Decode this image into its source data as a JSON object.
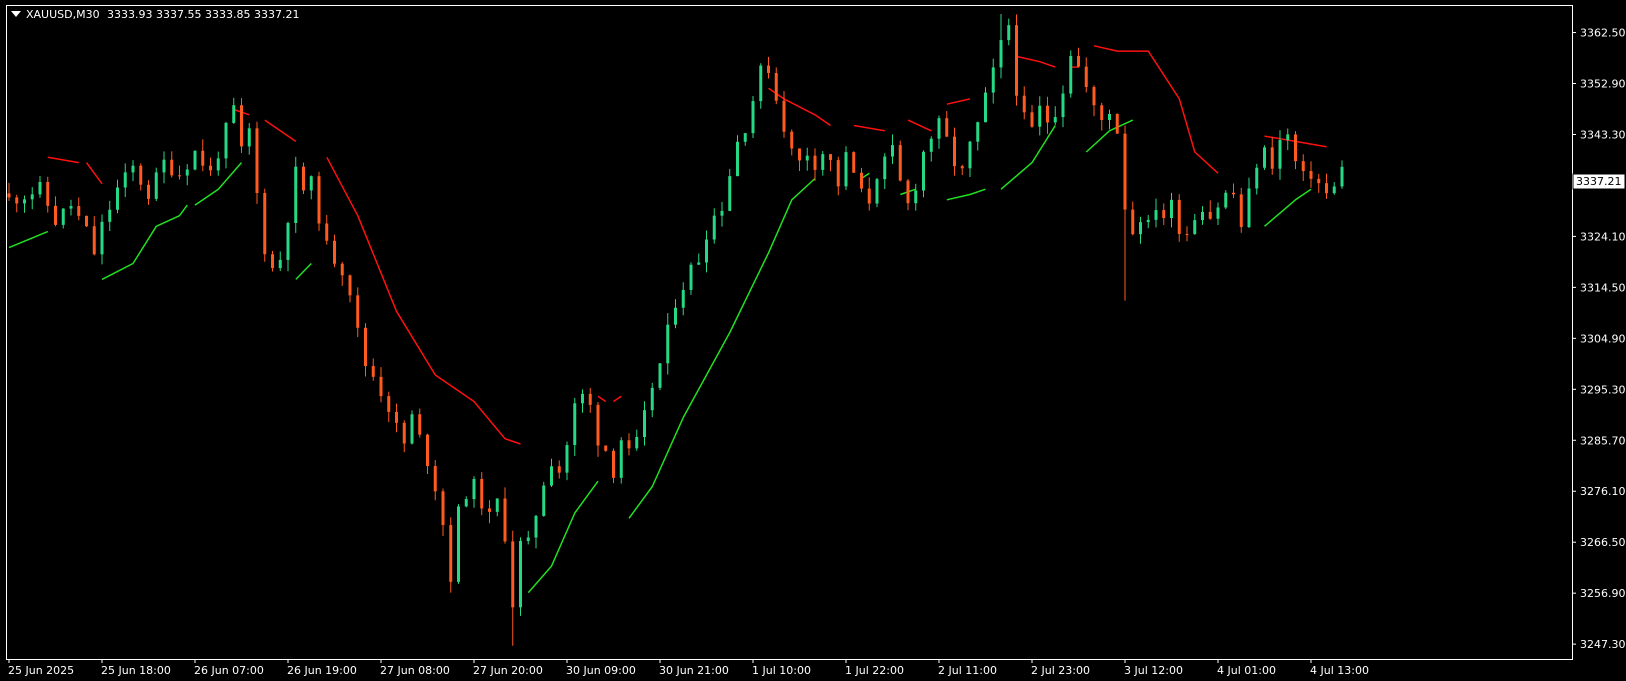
{
  "header": {
    "symbol": "XAUUSD,M30",
    "ohlc": "3333.93 3337.55 3333.85 3337.21"
  },
  "current_price_label": "3337.21",
  "colors": {
    "background": "#000000",
    "frame": "#ffffff",
    "bull_candle": "#26d984",
    "bear_candle": "#ff5a1f",
    "band_lower": "#21e021",
    "band_upper": "#ff1010",
    "text": "#ffffff"
  },
  "chart_data": {
    "type": "line",
    "instrument": "XAUUSD",
    "timeframe": "M30",
    "ylim": [
      3244.5,
      3367.5
    ],
    "y_ticks": [
      3362.5,
      3352.9,
      3343.3,
      3333.7,
      3324.1,
      3314.5,
      3304.9,
      3295.3,
      3285.7,
      3276.1,
      3266.5,
      3256.9,
      3247.3
    ],
    "y_tick_labels": [
      "3362.50",
      "3352.90",
      "3343.30",
      "3333.70",
      "3324.10",
      "3314.50",
      "3304.90",
      "3295.30",
      "3285.70",
      "3276.10",
      "3266.50",
      "3256.90",
      "3247.30"
    ],
    "x_range": [
      0,
      200
    ],
    "x_ticks": [
      0,
      12,
      24,
      36,
      48,
      60,
      72,
      84,
      96,
      108,
      120,
      132,
      144,
      156,
      168
    ],
    "x_tick_labels": [
      "25 Jun 2025",
      "25 Jun 18:00",
      "26 Jun 07:00",
      "26 Jun 19:00",
      "27 Jun 08:00",
      "27 Jun 20:00",
      "30 Jun 09:00",
      "30 Jun 21:00",
      "1 Jul 10:00",
      "1 Jul 22:00",
      "2 Jul 11:00",
      "2 Jul 23:00",
      "3 Jul 12:00",
      "4 Jul 01:00",
      "4 Jul 13:00"
    ],
    "price_anchors": [
      [
        0,
        3331
      ],
      [
        4,
        3333
      ],
      [
        6,
        3327
      ],
      [
        8,
        3330
      ],
      [
        10,
        3325
      ],
      [
        11,
        3321
      ],
      [
        12,
        3326
      ],
      [
        14,
        3333
      ],
      [
        16,
        3337
      ],
      [
        18,
        3332
      ],
      [
        20,
        3338
      ],
      [
        22,
        3336
      ],
      [
        24,
        3340
      ],
      [
        26,
        3336
      ],
      [
        28,
        3344
      ],
      [
        29,
        3348
      ],
      [
        30,
        3340
      ],
      [
        31,
        3344
      ],
      [
        32,
        3332
      ],
      [
        33,
        3322
      ],
      [
        34,
        3318
      ],
      [
        35,
        3320
      ],
      [
        36,
        3328
      ],
      [
        37,
        3336
      ],
      [
        38,
        3333
      ],
      [
        39,
        3334
      ],
      [
        40,
        3328
      ],
      [
        41,
        3322
      ],
      [
        42,
        3320
      ],
      [
        43,
        3318
      ],
      [
        44,
        3314
      ],
      [
        45,
        3306
      ],
      [
        46,
        3300
      ],
      [
        47,
        3298
      ],
      [
        48,
        3295
      ],
      [
        49,
        3292
      ],
      [
        50,
        3288
      ],
      [
        51,
        3285
      ],
      [
        52,
        3290
      ],
      [
        53,
        3286
      ],
      [
        54,
        3282
      ],
      [
        55,
        3277
      ],
      [
        56,
        3270
      ],
      [
        57,
        3260
      ],
      [
        58,
        3272
      ],
      [
        59,
        3276
      ],
      [
        60,
        3277
      ],
      [
        61,
        3274
      ],
      [
        62,
        3271
      ],
      [
        63,
        3274
      ],
      [
        64,
        3268
      ],
      [
        65,
        3255
      ],
      [
        66,
        3266
      ],
      [
        67,
        3266
      ],
      [
        68,
        3272
      ],
      [
        69,
        3278
      ],
      [
        70,
        3282
      ],
      [
        71,
        3280
      ],
      [
        72,
        3285
      ],
      [
        73,
        3292
      ],
      [
        74,
        3294
      ],
      [
        75,
        3292
      ],
      [
        76,
        3286
      ],
      [
        77,
        3284
      ],
      [
        78,
        3280
      ],
      [
        79,
        3286
      ],
      [
        80,
        3283
      ],
      [
        81,
        3285
      ],
      [
        82,
        3290
      ],
      [
        83,
        3296
      ],
      [
        84,
        3300
      ],
      [
        85,
        3306
      ],
      [
        86,
        3312
      ],
      [
        87,
        3315
      ],
      [
        88,
        3318
      ],
      [
        89,
        3320
      ],
      [
        90,
        3325
      ],
      [
        91,
        3328
      ],
      [
        92,
        3330
      ],
      [
        93,
        3336
      ],
      [
        94,
        3342
      ],
      [
        95,
        3345
      ],
      [
        96,
        3350
      ],
      [
        97,
        3355
      ],
      [
        98,
        3356
      ],
      [
        99,
        3350
      ],
      [
        100,
        3345
      ],
      [
        101,
        3340
      ],
      [
        102,
        3338
      ],
      [
        103,
        3340
      ],
      [
        104,
        3338
      ],
      [
        105,
        3340
      ],
      [
        106,
        3338
      ],
      [
        107,
        3334
      ],
      [
        108,
        3339
      ],
      [
        109,
        3336
      ],
      [
        110,
        3332
      ],
      [
        111,
        3331
      ],
      [
        112,
        3336
      ],
      [
        113,
        3338
      ],
      [
        114,
        3340
      ],
      [
        115,
        3334
      ],
      [
        116,
        3330
      ],
      [
        117,
        3334
      ],
      [
        118,
        3340
      ],
      [
        119,
        3343
      ],
      [
        120,
        3345
      ],
      [
        121,
        3342
      ],
      [
        122,
        3338
      ],
      [
        123,
        3336
      ],
      [
        124,
        3341
      ],
      [
        125,
        3345
      ],
      [
        126,
        3350
      ],
      [
        127,
        3355
      ],
      [
        128,
        3360
      ],
      [
        129,
        3364
      ],
      [
        130,
        3352
      ],
      [
        131,
        3346
      ],
      [
        132,
        3344
      ],
      [
        133,
        3348
      ],
      [
        134,
        3346
      ],
      [
        135,
        3348
      ],
      [
        136,
        3352
      ],
      [
        137,
        3359
      ],
      [
        138,
        3356
      ],
      [
        139,
        3352
      ],
      [
        140,
        3348
      ],
      [
        141,
        3346
      ],
      [
        142,
        3348
      ],
      [
        143,
        3344
      ],
      [
        144,
        3330
      ],
      [
        145,
        3325
      ],
      [
        146,
        3328
      ],
      [
        147,
        3326
      ],
      [
        148,
        3330
      ],
      [
        149,
        3328
      ],
      [
        150,
        3330
      ],
      [
        151,
        3326
      ],
      [
        152,
        3325
      ],
      [
        153,
        3328
      ],
      [
        154,
        3330
      ],
      [
        155,
        3328
      ],
      [
        156,
        3330
      ],
      [
        157,
        3332
      ],
      [
        158,
        3332
      ],
      [
        159,
        3326
      ],
      [
        160,
        3332
      ],
      [
        161,
        3338
      ],
      [
        162,
        3340
      ],
      [
        163,
        3338
      ],
      [
        164,
        3342
      ],
      [
        165,
        3343
      ],
      [
        166,
        3338
      ],
      [
        167,
        3335
      ],
      [
        168,
        3336
      ],
      [
        169,
        3334
      ],
      [
        170,
        3332
      ],
      [
        171,
        3333
      ],
      [
        172,
        3337.21
      ]
    ],
    "wick_spikes": [
      [
        57,
        3257
      ],
      [
        65,
        3247
      ],
      [
        144,
        3312
      ],
      [
        29,
        3349
      ],
      [
        128,
        3366
      ]
    ],
    "series": [
      {
        "style": "line",
        "color": "#ff1010",
        "segments": [
          [
            [
              5,
              3339
            ],
            [
              9,
              3338
            ]
          ],
          [
            [
              10,
              3338
            ],
            [
              12,
              3334
            ]
          ],
          [
            [
              29,
              3348
            ],
            [
              31,
              3347
            ]
          ],
          [
            [
              33,
              3346
            ],
            [
              37,
              3342
            ]
          ],
          [
            [
              41,
              3339
            ],
            [
              45,
              3328
            ],
            [
              50,
              3310
            ],
            [
              55,
              3298
            ],
            [
              60,
              3293
            ],
            [
              64,
              3286
            ],
            [
              66,
              3285
            ]
          ],
          [
            [
              76,
              3294
            ],
            [
              77,
              3293
            ]
          ],
          [
            [
              78,
              3293
            ],
            [
              79,
              3294
            ]
          ],
          [
            [
              98,
              3352
            ],
            [
              100,
              3350
            ],
            [
              104,
              3347
            ],
            [
              106,
              3345
            ]
          ],
          [
            [
              109,
              3345
            ],
            [
              113,
              3344
            ]
          ],
          [
            [
              116,
              3346
            ],
            [
              119,
              3344
            ]
          ],
          [
            [
              121,
              3349
            ],
            [
              124,
              3350
            ]
          ],
          [
            [
              130,
              3358
            ],
            [
              133,
              3357
            ],
            [
              135,
              3356
            ]
          ],
          [
            [
              137,
              3356
            ],
            [
              138,
              3356
            ]
          ],
          [
            [
              140,
              3360
            ],
            [
              143,
              3359
            ],
            [
              147,
              3359
            ],
            [
              151,
              3350
            ],
            [
              153,
              3340
            ],
            [
              156,
              3336
            ]
          ],
          [
            [
              162,
              3343
            ],
            [
              166,
              3342
            ],
            [
              170,
              3341
            ]
          ]
        ]
      },
      {
        "style": "line",
        "color": "#21e021",
        "segments": [
          [
            [
              0,
              3322
            ],
            [
              5,
              3325
            ]
          ],
          [
            [
              12,
              3316
            ],
            [
              16,
              3319
            ],
            [
              19,
              3326
            ],
            [
              22,
              3328
            ],
            [
              23,
              3330
            ]
          ],
          [
            [
              24,
              3330
            ],
            [
              27,
              3333
            ],
            [
              30,
              3338
            ]
          ],
          [
            [
              37,
              3316
            ],
            [
              39,
              3319
            ]
          ],
          [
            [
              67,
              3257
            ],
            [
              70,
              3262
            ],
            [
              73,
              3272
            ],
            [
              76,
              3278
            ]
          ],
          [
            [
              80,
              3271
            ],
            [
              83,
              3277
            ],
            [
              87,
              3290
            ],
            [
              93,
              3306
            ],
            [
              98,
              3321
            ],
            [
              101,
              3331
            ],
            [
              104,
              3335
            ]
          ],
          [
            [
              110,
              3335
            ],
            [
              111,
              3336
            ]
          ],
          [
            [
              115,
              3332
            ],
            [
              117,
              3333
            ]
          ],
          [
            [
              121,
              3331
            ],
            [
              124,
              3332
            ],
            [
              126,
              3333
            ]
          ],
          [
            [
              128,
              3333
            ],
            [
              132,
              3338
            ],
            [
              135,
              3345
            ]
          ],
          [
            [
              139,
              3340
            ],
            [
              142,
              3344
            ],
            [
              145,
              3346
            ]
          ],
          [
            [
              162,
              3326
            ],
            [
              166,
              3331
            ],
            [
              168,
              3333
            ]
          ]
        ]
      }
    ]
  }
}
